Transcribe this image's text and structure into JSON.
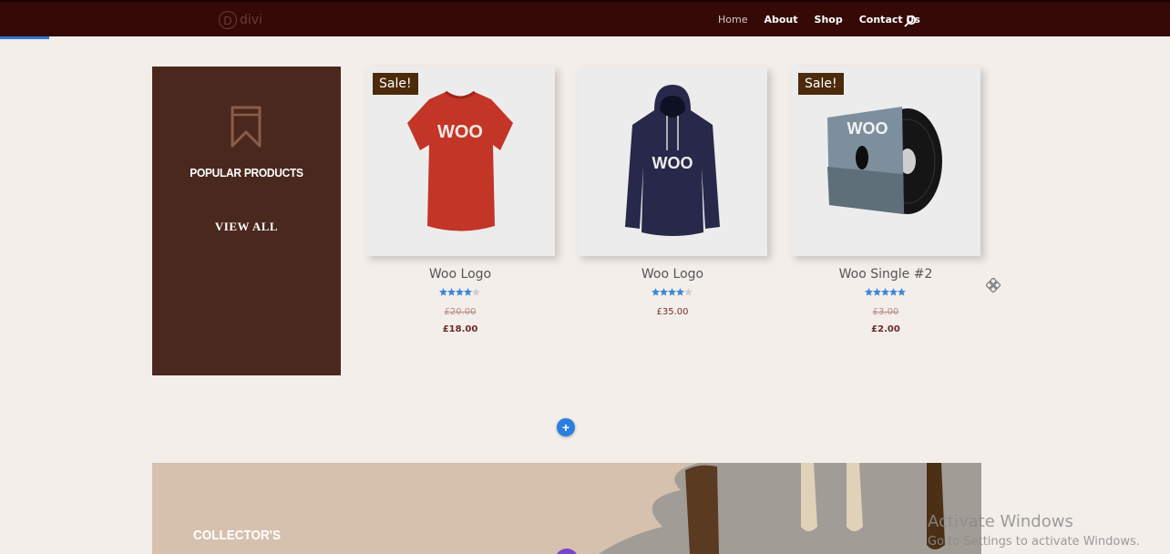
{
  "header": {
    "logo_letter": "D",
    "logo_text": "divi",
    "nav": [
      "Home",
      "About",
      "Shop",
      "Contact Us"
    ],
    "active_nav": "Home",
    "search_icon": "search-icon"
  },
  "promo": {
    "icon": "bookmark-icon",
    "title": "POPULAR PRODUCTS",
    "link": "VIEW ALL"
  },
  "products": [
    {
      "title": "Woo Logo",
      "badge": "Sale!",
      "rating": 4,
      "old_price": "£20.00",
      "price": "£18.00",
      "image": "red-tshirt"
    },
    {
      "title": "Woo Logo",
      "badge": "",
      "rating": 4,
      "old_price": "",
      "price": "£35.00",
      "image": "navy-hoodie"
    },
    {
      "title": "Woo Single #2",
      "badge": "Sale!",
      "rating": 4.5,
      "old_price": "£3.00",
      "price": "£2.00",
      "image": "vinyl-record"
    }
  ],
  "builder": {
    "add_label": "+",
    "move_icon": "move-icon"
  },
  "hero": {
    "title": "COLLECTOR'S"
  },
  "watermark": {
    "title": "Activate Windows",
    "subtitle": "Go to Settings to activate Windows."
  },
  "colors": {
    "topbar": "#340906",
    "promo_bg": "#4a281d",
    "badge": "#4c2a0a",
    "accent_blue": "#2b7ee0"
  }
}
